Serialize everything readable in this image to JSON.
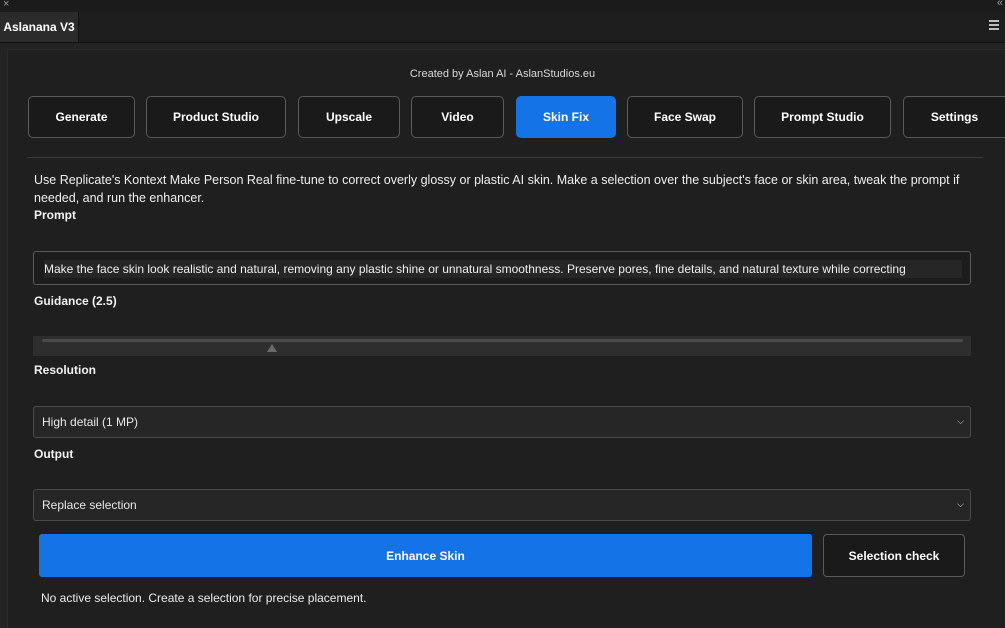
{
  "window": {
    "close_glyph": "×",
    "collapse_glyph": "«",
    "panel_title": "Aslanana V3",
    "menu_icon": "hamburger-menu-icon"
  },
  "credit": "Created by Aslan AI - AslanStudios.eu",
  "tabs": [
    {
      "label": "Generate",
      "active": false
    },
    {
      "label": "Product Studio",
      "active": false
    },
    {
      "label": "Upscale",
      "active": false
    },
    {
      "label": "Video",
      "active": false
    },
    {
      "label": "Skin Fix",
      "active": true
    },
    {
      "label": "Face Swap",
      "active": false
    },
    {
      "label": "Prompt Studio",
      "active": false
    },
    {
      "label": "Settings",
      "active": false
    }
  ],
  "skin_fix": {
    "description": "Use Replicate's Kontext Make Person Real fine-tune to correct overly glossy or plastic AI skin. Make a selection over the subject's face or skin area, tweak the prompt if needed, and run the enhancer.",
    "prompt_label": "Prompt",
    "prompt_value": "Make the face skin look realistic and natural, removing any plastic shine or unnatural smoothness. Preserve pores, fine details, and natural texture while correcting",
    "guidance_label": "Guidance (2.5)",
    "guidance_value": 2.5,
    "resolution_label": "Resolution",
    "resolution_value": "High detail (1 MP)",
    "output_label": "Output",
    "output_value": "Replace selection",
    "enhance_button": "Enhance Skin",
    "selection_check_button": "Selection check",
    "status": "No active selection. Create a selection for precise placement."
  },
  "colors": {
    "accent": "#1473e6",
    "background": "#1f1f1f"
  }
}
